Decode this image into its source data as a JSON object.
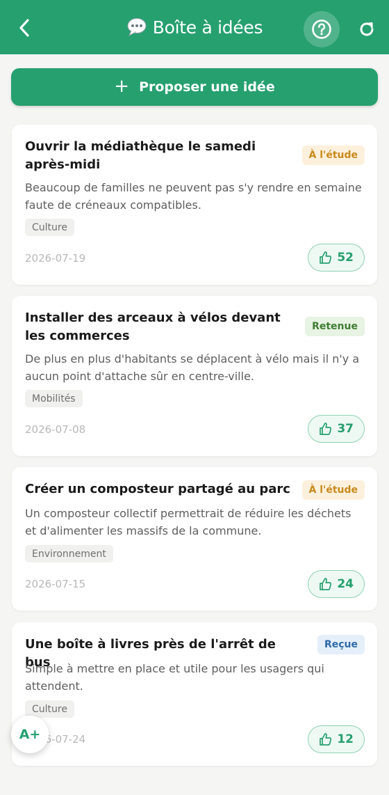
{
  "header": {
    "title": "Boîte à idées",
    "title_icon": "speech-bubble-icon",
    "back_icon": "chevron-left-icon",
    "help_icon": "question-circle-icon",
    "refresh_icon": "refresh-icon",
    "background_color": "#26a06f"
  },
  "actions": {
    "propose_label": "Proposer une idée",
    "propose_icon": "plus-icon",
    "font_size_label": "A+"
  },
  "ideas": [
    {
      "title": "Ouvrir la médiathèque le samedi après-midi",
      "status": "À l'étude",
      "description": "Beaucoup de familles ne peuvent pas s'y rendre en semaine faute de créneaux compatibles.",
      "tag": "Culture",
      "date": "2026-07-19",
      "votes": "52"
    },
    {
      "title": "Installer des arceaux à vélos devant les commerces",
      "status": "Retenue",
      "description": "De plus en plus d'habitants se déplacent à vélo mais il n'y a aucun point d'attache sûr en centre-ville.",
      "tag": "Mobilités",
      "date": "2026-07-08",
      "votes": "37"
    },
    {
      "title": "Créer un composteur partagé au parc",
      "status": "À l'étude",
      "description": "Un composteur collectif permettrait de réduire les déchets et d'alimenter les massifs de la commune.",
      "tag": "Environnement",
      "date": "2026-07-15",
      "votes": "24"
    },
    {
      "title": "Une boîte à livres près de l'arrêt de bus",
      "status": "Reçue",
      "description": "Simple à mettre en place et utile pour les usagers qui attendent.",
      "tag": "Culture",
      "date": "2026-07-24",
      "votes": "12"
    }
  ],
  "colors": {
    "accent": "#26a06f",
    "status_etude": "#c98a1b",
    "status_retenue": "#3f7d32",
    "status_recue": "#2d6aa6"
  }
}
